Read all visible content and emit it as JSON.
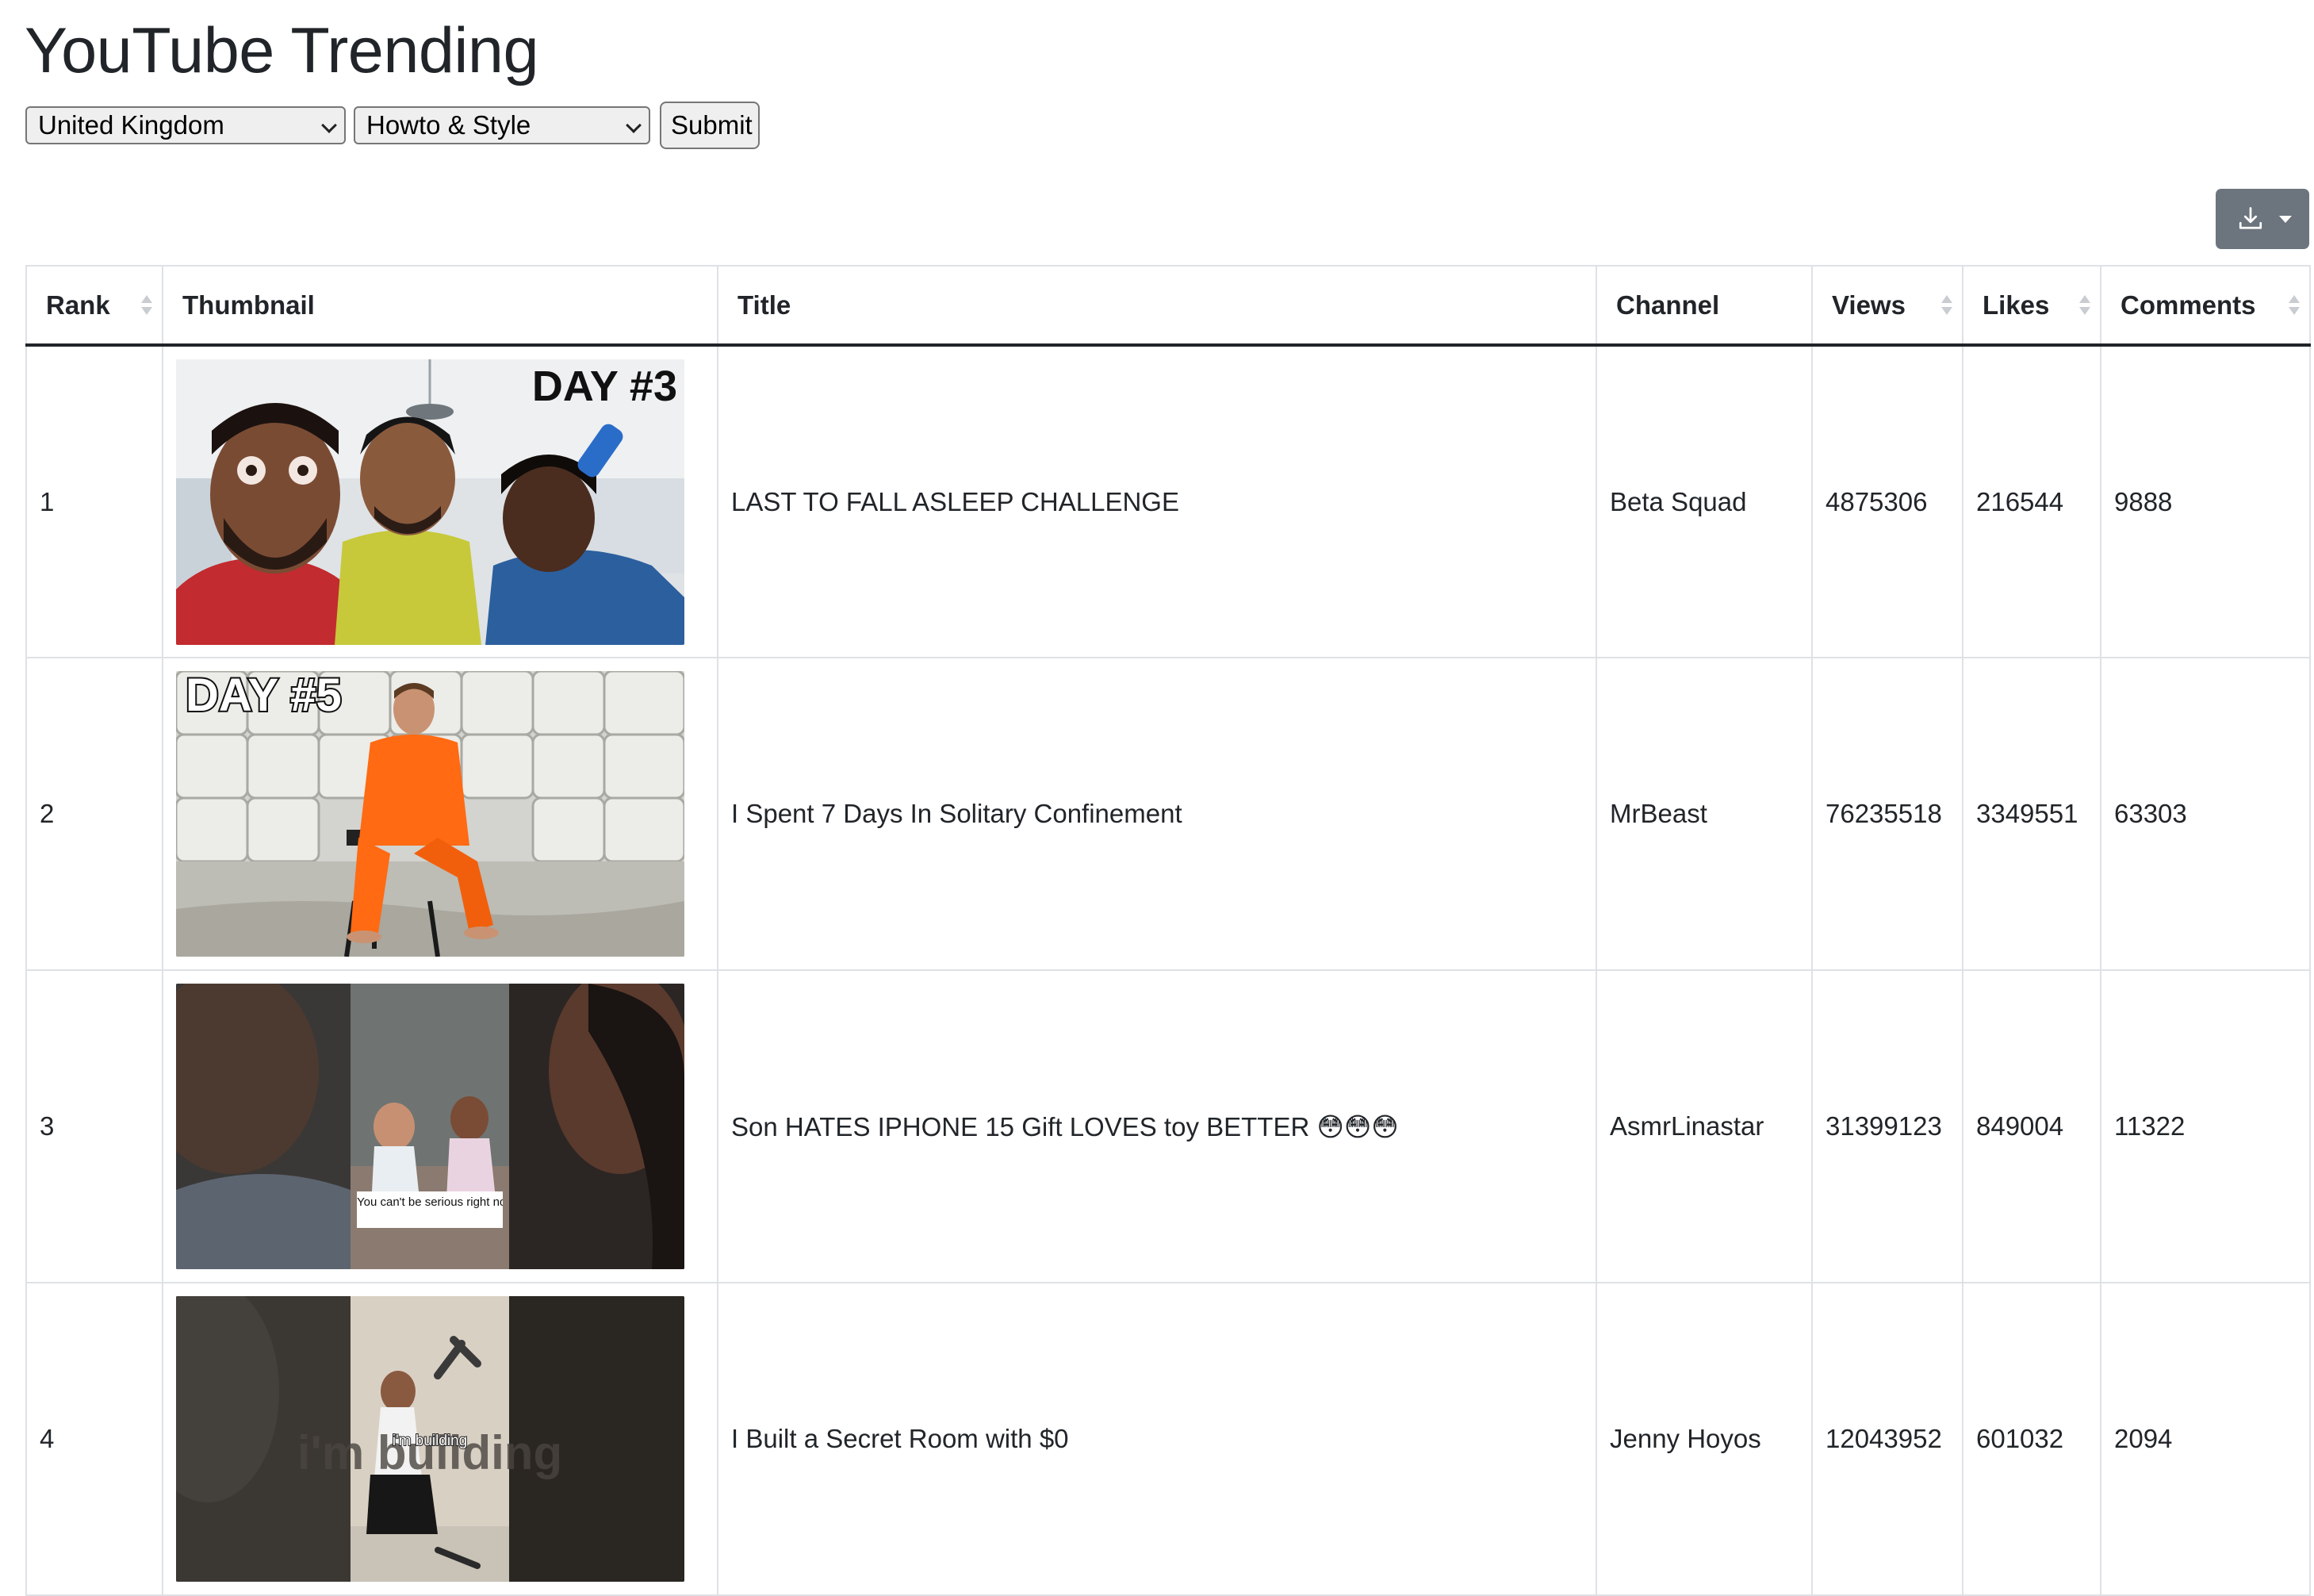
{
  "page": {
    "title": "YouTube Trending"
  },
  "filters": {
    "country_selected": "United Kingdom",
    "category_selected": "Howto & Style",
    "submit_label": "Submit"
  },
  "export": {
    "icon": "download-icon"
  },
  "table": {
    "columns": [
      "Rank",
      "Thumbnail",
      "Title",
      "Channel",
      "Views",
      "Likes",
      "Comments"
    ],
    "rows": [
      {
        "rank": "1",
        "thumbnail_badge": "DAY #3",
        "title": "LAST TO FALL ASLEEP CHALLENGE",
        "channel": "Beta Squad",
        "views": "4875306",
        "likes": "216544",
        "comments": "9888"
      },
      {
        "rank": "2",
        "thumbnail_badge": "DAY #5",
        "title": "I Spent 7 Days In Solitary Confinement",
        "channel": "MrBeast",
        "views": "76235518",
        "likes": "3349551",
        "comments": "63303"
      },
      {
        "rank": "3",
        "thumbnail_caption": "You can't be serious right now 😳😳😳",
        "title": "Son HATES IPHONE 15 Gift LOVES toy BETTER 😳😳😳",
        "channel": "AsmrLinastar",
        "views": "31399123",
        "likes": "849004",
        "comments": "11322"
      },
      {
        "rank": "4",
        "thumbnail_caption": "i'm building",
        "title": "I Built a Secret Room with $0",
        "channel": "Jenny Hoyos",
        "views": "12043952",
        "likes": "601032",
        "comments": "2094"
      }
    ]
  }
}
